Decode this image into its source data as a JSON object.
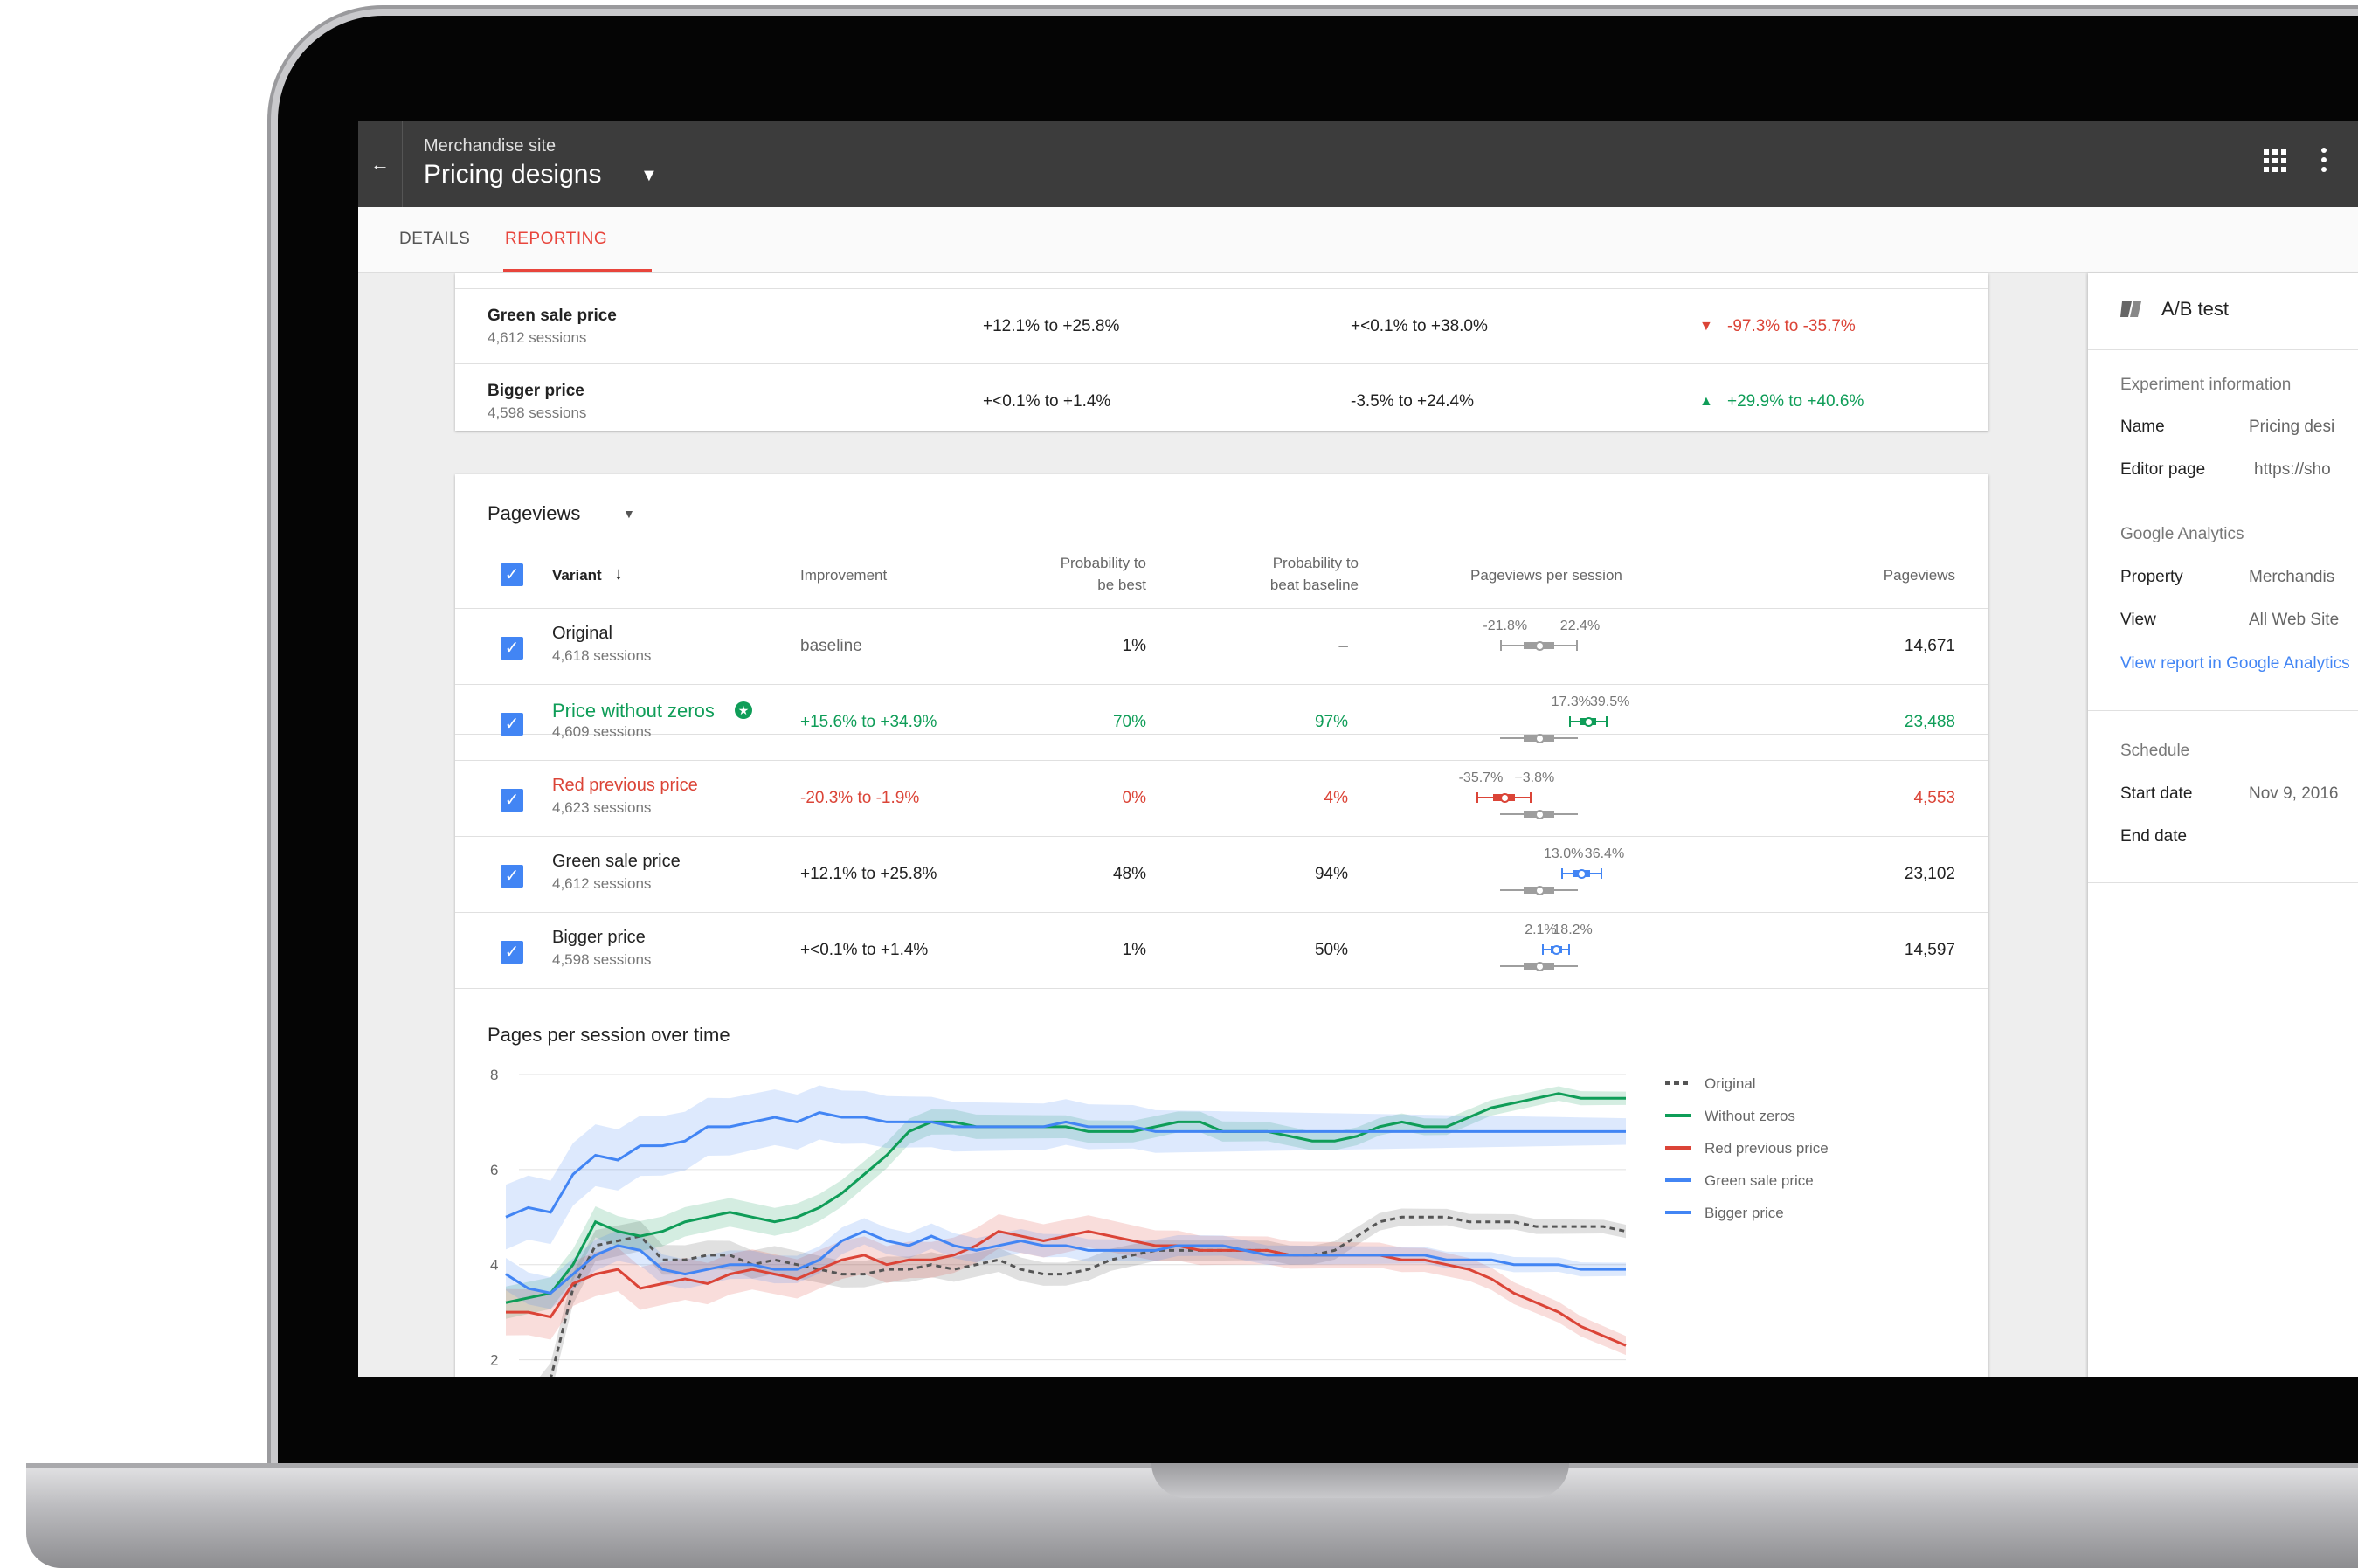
{
  "app": {
    "subtitle": "Merchandise site",
    "title": "Pricing designs",
    "tabs": [
      "DETAILS",
      "REPORTING"
    ],
    "active_tab": "REPORTING"
  },
  "top_table": {
    "rows": [
      {
        "name": "Green sale price",
        "sessions": "4,612 sessions",
        "c1": "+12.1% to +25.8%",
        "c2": "+<0.1% to +38.0%",
        "c3": "-97.3% to -35.7%",
        "c3_trend": "down"
      },
      {
        "name": "Bigger price",
        "sessions": "4,598 sessions",
        "c1": "+<0.1% to +1.4%",
        "c2": "-3.5% to +24.4%",
        "c3": "+29.9% to +40.6%",
        "c3_trend": "up"
      }
    ]
  },
  "pageviews": {
    "metric": "Pageviews",
    "headers": {
      "variant": "Variant",
      "improvement": "Improvement",
      "prob_best_1": "Probability to",
      "prob_best_2": "be best",
      "prob_beat_1": "Probability to",
      "prob_beat_2": "beat baseline",
      "per_session": "Pageviews per session",
      "pageviews": "Pageviews"
    },
    "rows": [
      {
        "name": "Original",
        "sessions": "4,618 sessions",
        "improvement": "baseline",
        "prob_best": "1%",
        "prob_beat": "–",
        "ci_low": "-21.8%",
        "ci_high": "22.4%",
        "pageviews": "14,671",
        "status": "neutral"
      },
      {
        "name": "Price without zeros",
        "sessions": "4,609 sessions",
        "improvement": "+15.6% to +34.9%",
        "prob_best": "70%",
        "prob_beat": "97%",
        "ci_low": "17.3%",
        "ci_high": "39.5%",
        "pageviews": "23,488",
        "status": "winner"
      },
      {
        "name": "Red previous price",
        "sessions": "4,623 sessions",
        "improvement": "-20.3% to -1.9%",
        "prob_best": "0%",
        "prob_beat": "4%",
        "ci_low": "-35.7%",
        "ci_high": "−3.8%",
        "pageviews": "4,553",
        "status": "loser"
      },
      {
        "name": "Green sale price",
        "sessions": "4,612 sessions",
        "improvement": "+12.1% to +25.8%",
        "prob_best": "48%",
        "prob_beat": "94%",
        "ci_low": "13.0%",
        "ci_high": "36.4%",
        "pageviews": "23,102",
        "status": "neutral"
      },
      {
        "name": "Bigger price",
        "sessions": "4,598 sessions",
        "improvement": "+<0.1% to +1.4%",
        "prob_best": "1%",
        "prob_beat": "50%",
        "ci_low": "2.1%",
        "ci_high": "18.2%",
        "pageviews": "14,597",
        "status": "neutral"
      }
    ]
  },
  "chart_title": "Pages per session over time",
  "chart_data": {
    "type": "line",
    "title": "Pages per session over time",
    "ylim": [
      1,
      8
    ],
    "yticks": [
      "2",
      "4",
      "6",
      "8"
    ],
    "series": [
      {
        "name": "Original",
        "color": "#555555",
        "style": "dashed",
        "values": [
          1.0,
          1.0,
          1.6,
          3.5,
          4.4,
          4.5,
          4.6,
          4.1,
          4.1,
          4.2,
          4.2,
          4.0,
          4.1,
          4.0,
          3.9,
          3.8,
          3.8,
          3.9,
          3.9,
          4.0,
          3.9,
          4.0,
          4.1,
          3.9,
          3.8,
          3.8,
          3.9,
          4.1,
          4.2,
          4.3,
          4.3,
          4.3,
          4.3,
          4.3,
          4.3,
          4.2,
          4.2,
          4.3,
          4.6,
          4.9,
          5.0,
          5.0,
          5.0,
          4.9,
          4.9,
          4.9,
          4.8,
          4.8,
          4.8,
          4.8,
          4.7
        ]
      },
      {
        "name": "Without zeros",
        "color": "#0f9d58",
        "style": "solid",
        "values": [
          3.2,
          3.3,
          3.4,
          4.0,
          4.9,
          4.7,
          4.6,
          4.7,
          4.9,
          5.0,
          5.1,
          5.0,
          4.9,
          5.0,
          5.2,
          5.5,
          5.9,
          6.3,
          6.8,
          7.0,
          7.0,
          6.9,
          6.9,
          6.9,
          6.9,
          6.9,
          6.8,
          6.8,
          6.8,
          6.9,
          7.0,
          7.0,
          6.8,
          6.8,
          6.8,
          6.7,
          6.6,
          6.6,
          6.7,
          6.9,
          7.0,
          6.9,
          6.9,
          7.1,
          7.3,
          7.4,
          7.5,
          7.6,
          7.5,
          7.5,
          7.5
        ]
      },
      {
        "name": "Red previous price",
        "color": "#db4437",
        "style": "solid",
        "values": [
          3.0,
          3.0,
          2.9,
          3.6,
          3.8,
          3.9,
          3.5,
          3.6,
          3.7,
          3.6,
          3.8,
          3.9,
          3.8,
          3.7,
          3.9,
          4.1,
          4.2,
          4.0,
          4.1,
          4.1,
          4.2,
          4.4,
          4.7,
          4.6,
          4.5,
          4.6,
          4.7,
          4.6,
          4.5,
          4.4,
          4.4,
          4.3,
          4.3,
          4.3,
          4.3,
          4.2,
          4.2,
          4.2,
          4.2,
          4.2,
          4.1,
          4.1,
          4.0,
          3.9,
          3.7,
          3.4,
          3.2,
          3.0,
          2.7,
          2.5,
          2.3
        ]
      },
      {
        "name": "Green sale price",
        "color": "#4285f4",
        "style": "solid",
        "values": [
          3.8,
          3.5,
          3.4,
          3.8,
          4.2,
          4.4,
          4.3,
          3.9,
          3.8,
          3.9,
          4.0,
          4.0,
          3.9,
          3.9,
          4.1,
          4.5,
          4.7,
          4.5,
          4.4,
          4.6,
          4.4,
          4.3,
          4.4,
          4.5,
          4.4,
          4.4,
          4.3,
          4.3,
          4.3,
          4.3,
          4.4,
          4.4,
          4.4,
          4.3,
          4.2,
          4.2,
          4.2,
          4.2,
          4.2,
          4.2,
          4.2,
          4.2,
          4.1,
          4.1,
          4.1,
          4.0,
          4.0,
          4.0,
          3.9,
          3.9,
          3.9
        ]
      },
      {
        "name": "Bigger price",
        "color": "#4285f4",
        "style": "solid",
        "values": [
          5.0,
          5.2,
          5.1,
          5.9,
          6.3,
          6.2,
          6.5,
          6.5,
          6.6,
          6.9,
          6.9,
          7.0,
          7.1,
          7.0,
          7.2,
          7.1,
          7.1,
          7.0,
          7.0,
          7.0,
          6.9,
          6.9,
          6.9,
          6.9,
          6.9,
          7.0,
          6.9,
          6.9,
          6.9,
          6.8,
          6.8,
          6.8,
          6.8,
          6.8,
          6.8,
          6.8,
          6.8,
          6.8,
          6.8,
          6.8,
          6.8,
          6.8,
          6.8,
          6.8,
          6.8,
          6.8,
          6.8,
          6.8,
          6.8,
          6.8,
          6.8
        ]
      }
    ]
  },
  "side": {
    "test_type": "A/B test",
    "experiment_info": "Experiment information",
    "name_label": "Name",
    "name_value": "Pricing desi",
    "editor_label": "Editor page",
    "editor_value": "https://sho",
    "ga_heading": "Google Analytics",
    "property_label": "Property",
    "property_value": "Merchandis",
    "view_label": "View",
    "view_value": "All Web Site",
    "report_link": "View report in Google Analytics",
    "schedule": "Schedule",
    "start_label": "Start date",
    "start_value": "Nov 9, 2016",
    "end_label": "End date"
  },
  "colors": {
    "accent": "#e8453c",
    "checkbox": "#4285f4",
    "green": "#0f9d58",
    "red": "#db4437",
    "appbar": "#3c3c3c"
  }
}
